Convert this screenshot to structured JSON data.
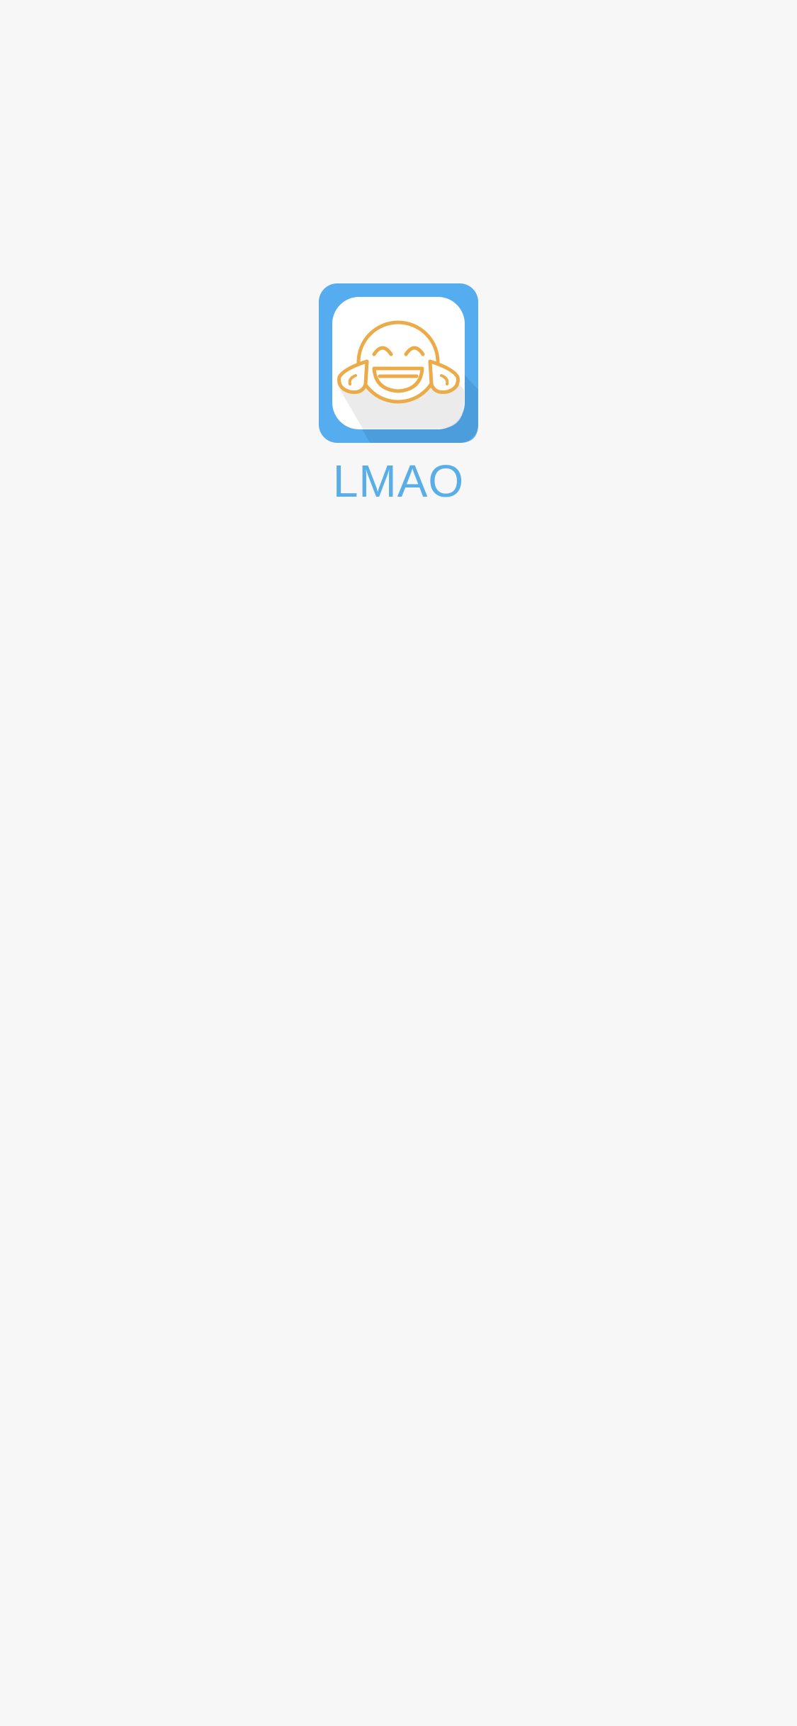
{
  "app": {
    "name": "LMAO",
    "icon": "laughing-face-icon"
  },
  "colors": {
    "background": "#f7f7f7",
    "brand_blue": "#55acee",
    "icon_face": "#ebab48",
    "name_text": "#5aaee8"
  }
}
